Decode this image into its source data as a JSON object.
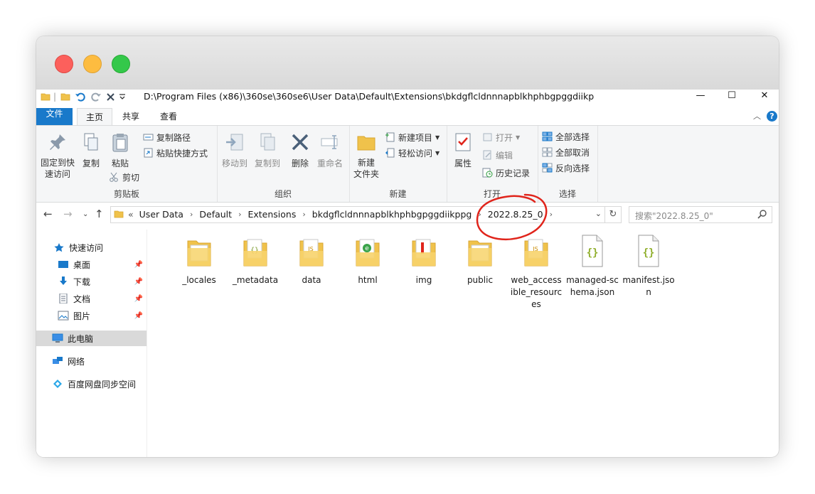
{
  "window": {
    "title_path": "D:\\Program Files (x86)\\360se\\360se6\\User Data\\Default\\Extensions\\bkdgflcldnnnapblkhphbgpggdiikp",
    "controls": {
      "minimize": "—",
      "maximize": "☐",
      "close": "✕"
    }
  },
  "ribbon": {
    "tabs": [
      "文件",
      "主页",
      "共享",
      "查看"
    ],
    "clipboard": {
      "pin_label": "固定到快\n速访问",
      "copy": "复制",
      "paste": "粘贴",
      "copy_path": "复制路径",
      "paste_shortcut": "粘贴快捷方式",
      "cut": "剪切",
      "group": "剪贴板"
    },
    "organize": {
      "move_to": "移动到",
      "copy_to": "复制到",
      "delete": "删除",
      "rename": "重命名",
      "group": "组织"
    },
    "new": {
      "new_folder": "新建\n文件夹",
      "new_item": "新建项目",
      "easy_access": "轻松访问",
      "group": "新建"
    },
    "open": {
      "properties": "属性",
      "open": "打开",
      "edit": "编辑",
      "history": "历史记录",
      "group": "打开"
    },
    "select": {
      "select_all": "全部选择",
      "select_none": "全部取消",
      "invert": "反向选择",
      "group": "选择"
    }
  },
  "address": {
    "overflow": "«",
    "crumbs": [
      "User Data",
      "Default",
      "Extensions",
      "bkdgflcldnnnapblkhphbgpggdiikppg",
      "2022.8.25_0"
    ],
    "search_placeholder": "搜索\"2022.8.25_0\""
  },
  "nav": {
    "quick_access": "快速访问",
    "desktop": "桌面",
    "downloads": "下载",
    "documents": "文档",
    "pictures": "图片",
    "this_pc": "此电脑",
    "network": "网络",
    "baidu": "百度网盘同步空间"
  },
  "files": [
    {
      "name": "_locales",
      "type": "folder"
    },
    {
      "name": "_metadata",
      "type": "folder"
    },
    {
      "name": "data",
      "type": "folder"
    },
    {
      "name": "html",
      "type": "folder"
    },
    {
      "name": "img",
      "type": "folder"
    },
    {
      "name": "public",
      "type": "folder"
    },
    {
      "name": "web_accessible_resources",
      "type": "folder"
    },
    {
      "name": "managed-schema.json",
      "type": "json"
    },
    {
      "name": "manifest.json",
      "type": "json"
    }
  ],
  "colors": {
    "accent": "#1979ca",
    "folder": "#f0c24b",
    "annotation": "#e0241b"
  }
}
